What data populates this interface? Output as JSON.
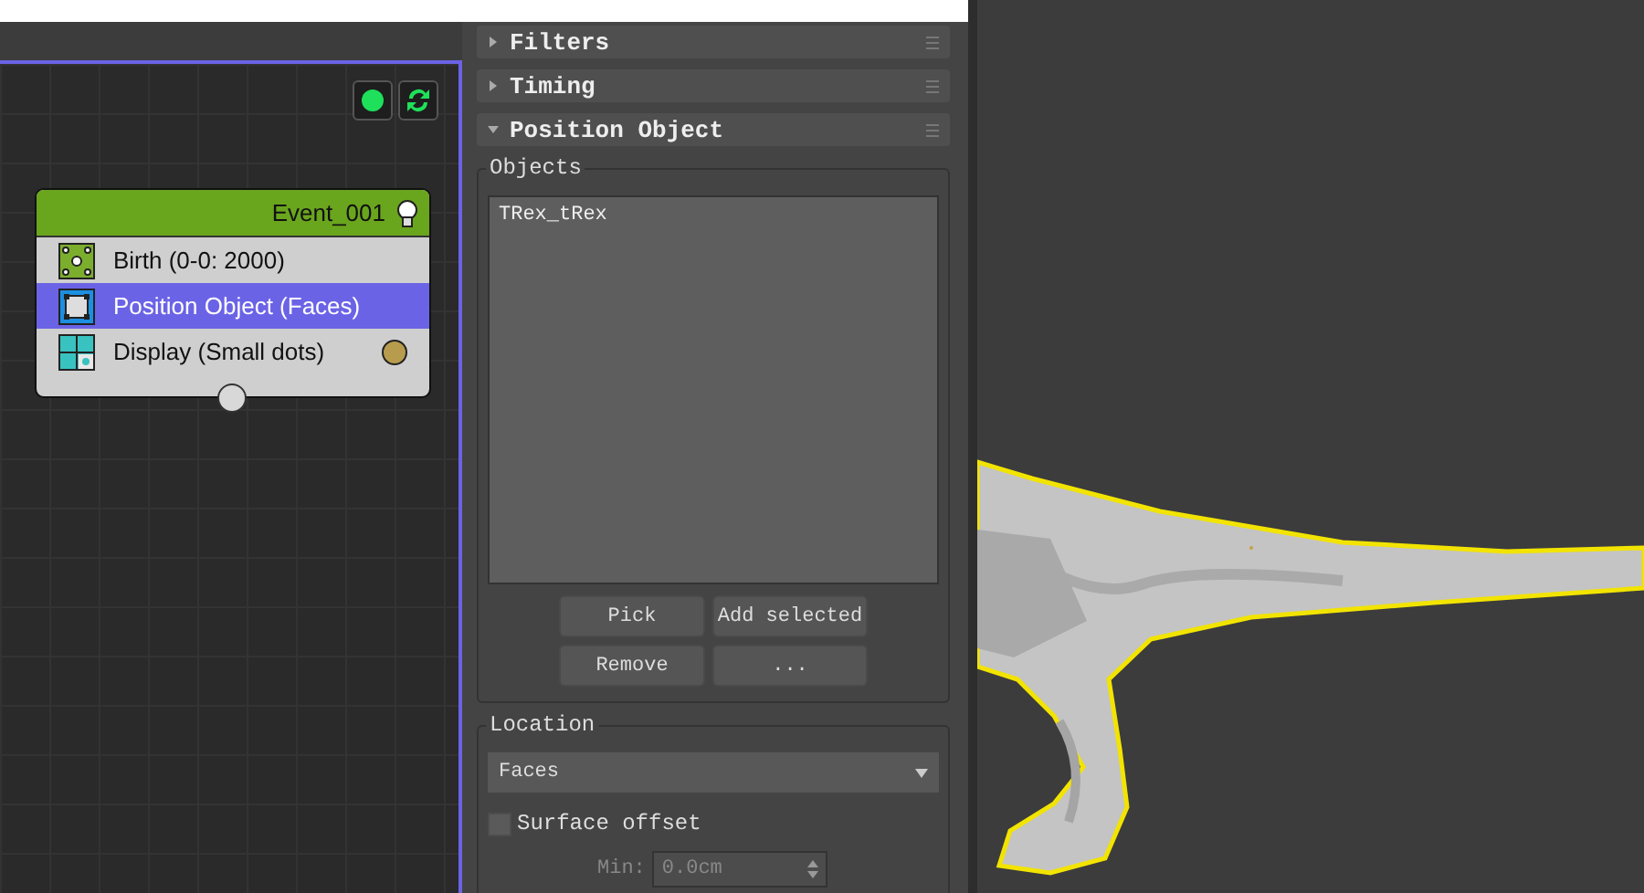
{
  "node_editor": {
    "event": {
      "title": "Event_001",
      "operators": [
        {
          "label": "Birth (0-0: 2000)",
          "kind": "birth",
          "selected": false
        },
        {
          "label": "Position Object (Faces)",
          "kind": "position",
          "selected": true
        },
        {
          "label": "Display (Small dots)",
          "kind": "display",
          "selected": false
        }
      ]
    }
  },
  "rollouts": [
    {
      "title": "Filters",
      "expanded": false
    },
    {
      "title": "Timing",
      "expanded": false
    },
    {
      "title": "Position Object",
      "expanded": true
    }
  ],
  "objects": {
    "label": "Objects",
    "items": [
      "TRex_tRex"
    ],
    "buttons": [
      "Pick",
      "Add selected",
      "Remove",
      "..."
    ]
  },
  "location": {
    "label": "Location",
    "value": "Faces",
    "surface_offset": {
      "label": "Surface offset",
      "checked": false
    },
    "min": {
      "label": "Min:",
      "value": "0.0cm",
      "disabled": true
    }
  }
}
